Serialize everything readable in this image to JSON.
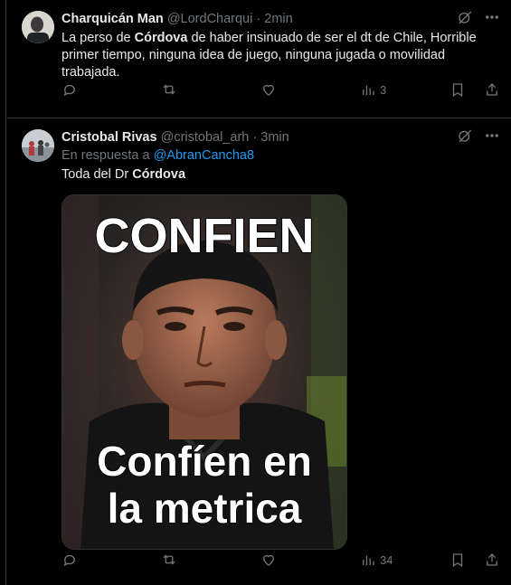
{
  "tweets": [
    {
      "name": "Charquicán Man",
      "handle": "@LordCharqui",
      "separator": "·",
      "time": "2min",
      "text_pre": "La perso de ",
      "text_bold": "Córdova",
      "text_post": " de haber insinuado de ser el dt de Chile, Horrible primer tiempo, ninguna idea de juego, ninguna jugada o movilidad trabajada.",
      "views": "3"
    },
    {
      "name": "Cristobal Rivas",
      "handle": "@cristobal_arh",
      "separator": "·",
      "time": "3min",
      "reply_prefix": "En respuesta a ",
      "reply_to": "@AbranCancha8",
      "text_pre": "Toda del Dr ",
      "text_bold": "Córdova",
      "meme_top": "CONFIEN",
      "meme_bottom_1": "Confíen en",
      "meme_bottom_2": "la metrica",
      "views": "34"
    }
  ],
  "colors": {
    "background": "#000000",
    "text": "#e7e9ea",
    "muted": "#71767b",
    "link": "#1d9bf0",
    "border": "#2f3336"
  },
  "icons": [
    "grok-icon",
    "more-icon",
    "reply-icon",
    "retweet-icon",
    "like-icon",
    "views-icon",
    "bookmark-icon",
    "share-icon"
  ]
}
